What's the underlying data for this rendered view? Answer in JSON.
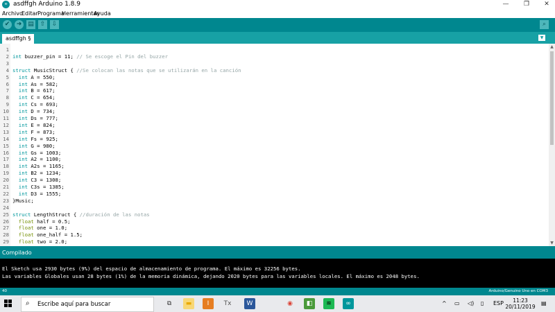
{
  "window": {
    "app_icon": "arduino-logo-icon",
    "title": "asdffgh Arduino 1.8.9",
    "controls": [
      "—",
      "❐",
      "✕"
    ]
  },
  "menu": [
    "Archivo",
    "Editar",
    "Programa",
    "Herramientas",
    "Ayuda"
  ],
  "toolbar": {
    "buttons": [
      {
        "name": "verify-icon",
        "glyph": "✔"
      },
      {
        "name": "upload-icon",
        "glyph": "➜"
      },
      {
        "name": "new-icon",
        "glyph": "▤"
      },
      {
        "name": "open-icon",
        "glyph": "⇧"
      },
      {
        "name": "save-icon",
        "glyph": "⇩"
      }
    ],
    "serial_monitor_icon": "⌕"
  },
  "tab": {
    "label": "asdffgh §",
    "menu_glyph": "▼"
  },
  "editor": {
    "lines": [
      {
        "n": "1",
        "t": ""
      },
      {
        "n": "2",
        "t": "int buzzer_pin = 11; // Se escoge el Pin del buzzer"
      },
      {
        "n": "3",
        "t": ""
      },
      {
        "n": "4",
        "t": "struct MusicStruct { //Se colocan las notas que se utilizarán en la canción"
      },
      {
        "n": "5",
        "t": "  int A = 550;"
      },
      {
        "n": "6",
        "t": "  int As = 582;"
      },
      {
        "n": "7",
        "t": "  int B = 617;"
      },
      {
        "n": "8",
        "t": "  int C = 654;"
      },
      {
        "n": "9",
        "t": "  int Cs = 693;"
      },
      {
        "n": "10",
        "t": "  int D = 734;"
      },
      {
        "n": "11",
        "t": "  int Ds = 777;"
      },
      {
        "n": "12",
        "t": "  int E = 824;"
      },
      {
        "n": "13",
        "t": "  int F = 873;"
      },
      {
        "n": "14",
        "t": "  int Fs = 925;"
      },
      {
        "n": "15",
        "t": "  int G = 980;"
      },
      {
        "n": "16",
        "t": "  int Gs = 1003;"
      },
      {
        "n": "17",
        "t": "  int A2 = 1100;"
      },
      {
        "n": "18",
        "t": "  int A2s = 1165;"
      },
      {
        "n": "19",
        "t": "  int B2 = 1234;"
      },
      {
        "n": "20",
        "t": "  int C3 = 1308;"
      },
      {
        "n": "21",
        "t": "  int C3s = 1385;"
      },
      {
        "n": "22",
        "t": "  int D3 = 1555;"
      },
      {
        "n": "23",
        "t": "}Music;"
      },
      {
        "n": "24",
        "t": ""
      },
      {
        "n": "25",
        "t": "struct LengthStruct { //duración de las notas"
      },
      {
        "n": "26",
        "t": "  float half = 0.5;"
      },
      {
        "n": "27",
        "t": "  float one = 1.0;"
      },
      {
        "n": "28",
        "t": "  float one_half = 1.5;"
      },
      {
        "n": "29",
        "t": "  float two = 2.0;"
      }
    ]
  },
  "status": {
    "message": "Compilado"
  },
  "console": {
    "lines": [
      "El Sketch usa 2930 bytes (9%) del espacio de almacenamiento de programa. El máximo es 32256 bytes.",
      "Las variables Globales usan 28 bytes (1%) de la memoria dinámica, dejando 2020 bytes para las variables locales. El máximo es 2048 bytes."
    ]
  },
  "bottom": {
    "line_number": "40",
    "board": "Arduino/Genuino Uno en COM3"
  },
  "taskbar": {
    "search_placeholder": "Escribe aquí para buscar",
    "apps": [
      {
        "name": "task-view-icon",
        "glyph": "⧉",
        "color": "#333333",
        "bg": "#e9eaed"
      },
      {
        "name": "file-explorer-icon",
        "glyph": "▬",
        "color": "#e8a800",
        "bg": "#f8d775"
      },
      {
        "name": "app-orange-icon",
        "glyph": "I",
        "color": "#ffffff",
        "bg": "#e67e22"
      },
      {
        "name": "app-tx-icon",
        "glyph": "Tx",
        "color": "#555555",
        "bg": "#e9eaed"
      },
      {
        "name": "word-icon",
        "glyph": "W",
        "color": "#ffffff",
        "bg": "#2b579a"
      },
      {
        "name": "chrome-icon",
        "glyph": "◉",
        "color": "#db4437",
        "bg": "#e9eaed"
      },
      {
        "name": "app-green-icon",
        "glyph": "◧",
        "color": "#ffffff",
        "bg": "#4a9a3a"
      },
      {
        "name": "spotify-icon",
        "glyph": "≋",
        "color": "#000000",
        "bg": "#1db954"
      },
      {
        "name": "arduino-icon",
        "glyph": "∞",
        "color": "#ffffff",
        "bg": "#00979c"
      }
    ],
    "tray": {
      "chevron": "^",
      "language": "ESP",
      "time": "11:23",
      "date": "20/11/2019"
    }
  },
  "colors": {
    "keyword": "#00979c",
    "type_float": "#728e00",
    "comment": "#95a5a6",
    "teal": "#00878f",
    "console_bg": "#000000"
  }
}
